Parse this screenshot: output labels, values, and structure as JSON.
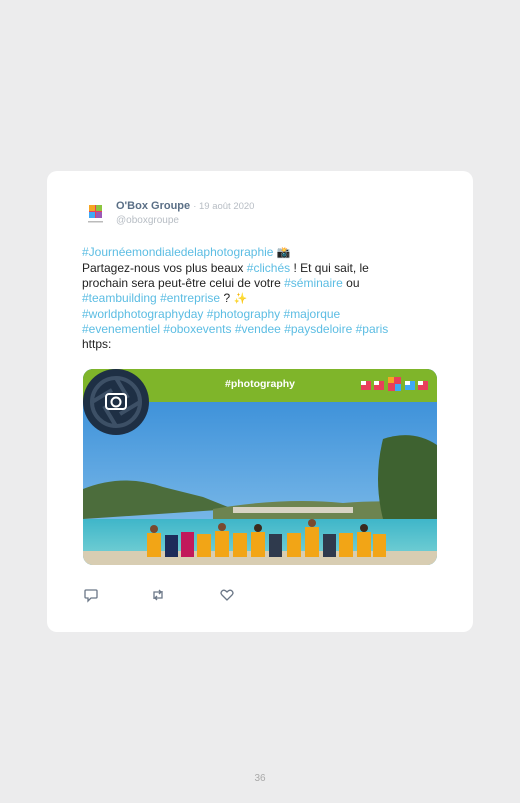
{
  "tweet": {
    "author_name": "O'Box Groupe",
    "date": "· 19 août 2020",
    "handle": "@oboxgroupe",
    "lines": [
      {
        "hashtag": "#Journéemondialedelaphotographie",
        "emoji": "📸"
      },
      {
        "t1": "Partagez-nous vos plus beaux ",
        "tag": "#clichés",
        "t2": " ! Et qui sait, le"
      },
      {
        "t1": "prochain sera peut-être celui de votre ",
        "tag": "#séminaire",
        "t2": " ou"
      },
      {
        "tag1": "#teambuilding",
        "tag2": "#entreprise",
        "t": " ? ",
        "emoji": "✨"
      },
      {
        "tag1": "#worldphotographyday",
        "tag2": "#photography",
        "tag3": "#majorque"
      },
      {
        "tag1": "#evenementiel",
        "tag2": "#oboxevents",
        "tag3": "#vendee",
        "tag4": "#paysdeloire",
        "tag5": "#paris"
      },
      {
        "t": "https:"
      }
    ]
  },
  "media": {
    "banner_title": "#photography",
    "banner_color": "#7fb52a",
    "scene": "group of people in orange life jackets on a beach in front of a turquoise bay"
  },
  "actions": [
    "reply-icon",
    "retweet-icon",
    "like-icon"
  ],
  "page_number": "36"
}
